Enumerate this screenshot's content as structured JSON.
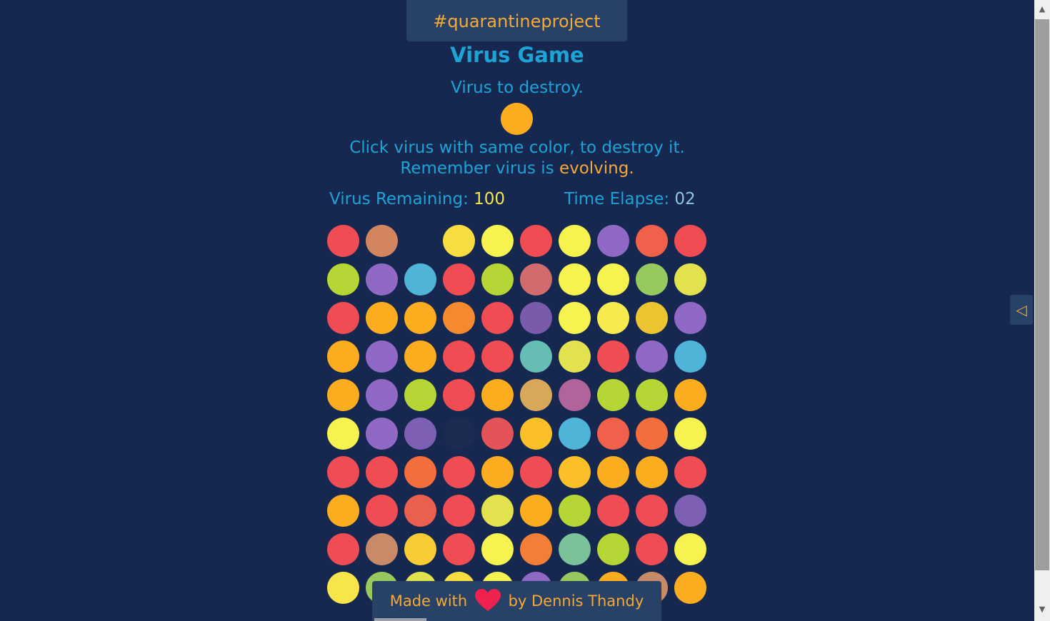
{
  "tagline": "#quarantineproject",
  "title": "Virus Game",
  "subtitle": "Virus to destroy.",
  "target_color": "#fbad1f",
  "instructions": {
    "line1": "Click virus with same color, to destroy it.",
    "line2_prefix": "Remember virus is ",
    "line2_highlight": "evolving."
  },
  "stats": {
    "remaining_label": "Virus Remaining:",
    "remaining_value": "100",
    "time_label": "Time Elapse:",
    "time_value": "02"
  },
  "grid": [
    [
      "#ef4d53",
      "#d2855e",
      null,
      "#f8dd40",
      "#f6f250",
      "#ef4d53",
      "#f6f250",
      "#9069c6",
      "#f0604a",
      "#ef4d53"
    ],
    [
      "#b5d634",
      "#9069c6",
      "#4fb4d7",
      "#ef4d53",
      "#b5d634",
      "#d16b6d",
      "#f6f250",
      "#f6f250",
      "#97c95f",
      "#e2e24e"
    ],
    [
      "#ef4d53",
      "#fbad1f",
      "#fbad1f",
      "#f4892f",
      "#ef4d53",
      "#7a5bab",
      "#f6f250",
      "#f6ea4f",
      "#ebc430",
      "#9069c6"
    ],
    [
      "#fbad1f",
      "#9069c6",
      "#fbad1f",
      "#ef4d53",
      "#ef4d53",
      "#66bdb3",
      "#e2e24e",
      "#ef4d53",
      "#9069c6",
      "#4fb4d7"
    ],
    [
      "#fbad1f",
      "#9069c6",
      "#b5d634",
      "#ef4d53",
      "#fbad1f",
      "#d8a85a",
      "#b0649a",
      "#b5d634",
      "#b5d634",
      "#fbad1f"
    ],
    [
      "#f6f250",
      "#9069c6",
      "#7d5fb4",
      "#1c2b52",
      "#e35358",
      "#fbbf28",
      "#4fb4d7",
      "#f0604a",
      "#f36d3d",
      "#f6f250"
    ],
    [
      "#ef4d53",
      "#ef4d53",
      "#f36d3d",
      "#ef4d53",
      "#fbad1f",
      "#ef4d53",
      "#fbbf28",
      "#fbad1f",
      "#fbad1f",
      "#ef4d53"
    ],
    [
      "#fbad1f",
      "#ef4d53",
      "#ea604f",
      "#ef4d53",
      "#e2e24e",
      "#fbad1f",
      "#b5d634",
      "#ef4d53",
      "#ef4d53",
      "#7d5fb4"
    ],
    [
      "#ef4d53",
      "#c98a68",
      "#f9cc36",
      "#ef4d53",
      "#f6f250",
      "#f37f37",
      "#7bc19a",
      "#b5d634",
      "#ef4d53",
      "#f6f250"
    ],
    [
      "#f8e54a",
      "#97c95f",
      "#e2e24e",
      "#f8dd40",
      "#f6f250",
      "#9069c6",
      "#97c95f",
      "#fbad1f",
      "#c98a68",
      "#fbad1f"
    ]
  ],
  "footer": {
    "prefix": "Made with",
    "suffix": "by Dennis Thandy",
    "heart_color": "#f0204f"
  },
  "icons": {
    "side_panel": "collapse-left-icon",
    "scroll_up": "triangle-up-icon",
    "scroll_down": "triangle-down-icon"
  }
}
